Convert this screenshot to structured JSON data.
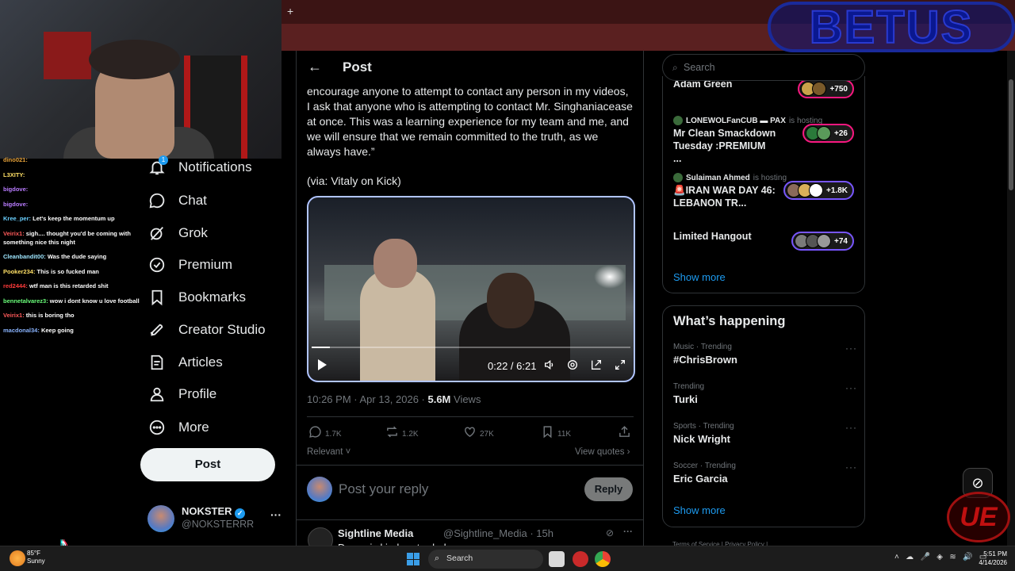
{
  "browser": {
    "new_tab": "+",
    "ad_text": "BETUS"
  },
  "chat": [
    {
      "user": "dino021:",
      "color": "#e8a33a",
      "text": ""
    },
    {
      "user": "L3XITY:",
      "color": "#ffe066",
      "text": ""
    },
    {
      "user": "bigdove:",
      "color": "#b97cff",
      "text": ""
    },
    {
      "user": "bigdove:",
      "color": "#b97cff",
      "text": ""
    },
    {
      "user": "Kree_per:",
      "color": "#6ad0ff",
      "text": "Let's keep the momentum up"
    },
    {
      "user": "Veirix1:",
      "color": "#ff5a5a",
      "text": "sigh.... thought you'd be coming with something nice this night"
    },
    {
      "user": "Cleanbandit00:",
      "color": "#9ee6ff",
      "text": "Was the dude saying"
    },
    {
      "user": "Pooker234:",
      "color": "#ffe066",
      "text": "This is so fucked man"
    },
    {
      "user": "red2444:",
      "color": "#ff3b3b",
      "text": "wtf man is this retarded shit"
    },
    {
      "user": "bennetalvarez3:",
      "color": "#6aff7a",
      "text": "wow i dont know u love football"
    },
    {
      "user": "Veirix1:",
      "color": "#ff5a5a",
      "text": "this is boring tho"
    },
    {
      "user": "macdonal34:",
      "color": "#8ab4ff",
      "text": "Keep going"
    }
  ],
  "nav": {
    "notifications": "Notifications",
    "notifications_badge": "1",
    "chat": "Chat",
    "grok": "Grok",
    "premium": "Premium",
    "bookmarks": "Bookmarks",
    "creator_studio": "Creator Studio",
    "articles": "Articles",
    "profile": "Profile",
    "more": "More",
    "post_button": "Post"
  },
  "account": {
    "name": "NOKSTER",
    "handle": "@NOKSTERRR",
    "more": "···"
  },
  "post": {
    "header_title": "Post",
    "body": "encourage anyone to attempt to contact any person in my videos, I ask that anyone who is attempting to contact Mr. Singhaniacease at once. This was a learning experience for my team and me, and we will ensure that we remain committed to the truth, as we always have.”",
    "via": "(via: Vitaly on Kick)",
    "video_time": "0:22 / 6:21",
    "video_progress": 0.058,
    "timestamp": "10:26 PM · Apr 13, 2026 · ",
    "views_count": "5.6M",
    "views_label": " Views",
    "replies": "1.7K",
    "reposts": "1.2K",
    "likes": "27K",
    "bookmarks": "11K",
    "relevant": "Relevant ˅",
    "view_quotes": "View quotes ›"
  },
  "reply": {
    "placeholder": "Post your reply",
    "button": "Reply"
  },
  "next_tweet": {
    "name": "Sightline Media",
    "handle": "@Sightline_Media · 15h",
    "text": "Decoy is kinda retarded"
  },
  "search": {
    "placeholder": "Search"
  },
  "live": [
    {
      "host": "",
      "is_hosting": "",
      "title": "Adam Green",
      "count": "+750",
      "pill": "pink"
    },
    {
      "host": "LONEWOLFanCUB ▬ PAX",
      "is_hosting": "is hosting",
      "title": "Mr Clean Smackdown Tuesday :PREMIUM ...",
      "count": "+26",
      "pill": "pink"
    },
    {
      "host": "Sulaiman Ahmed",
      "is_hosting": "is hosting",
      "title": "🚨IRAN WAR DAY 46: LEBANON TR...",
      "count": "+1.8K",
      "pill": "purple"
    },
    {
      "host": "",
      "is_hosting": "",
      "title": "Limited Hangout",
      "count": "+74",
      "pill": "purple"
    }
  ],
  "live_show_more": "Show more",
  "happening": {
    "title": "What’s happening",
    "trends": [
      {
        "category": "Music · Trending",
        "name": "#ChrisBrown"
      },
      {
        "category": "Trending",
        "name": "Turki"
      },
      {
        "category": "Sports · Trending",
        "name": "Nick Wright"
      },
      {
        "category": "Soccer · Trending",
        "name": "Eric Garcia"
      }
    ],
    "show_more": "Show more"
  },
  "footer_hint": "Terms of Service  |  Privacy Policy  |",
  "overlay": {
    "ue": "UE"
  },
  "taskbar": {
    "temp": "85°F",
    "condition": "Sunny",
    "search": "Search",
    "time": "5:51 PM",
    "date": "4/14/2026"
  }
}
